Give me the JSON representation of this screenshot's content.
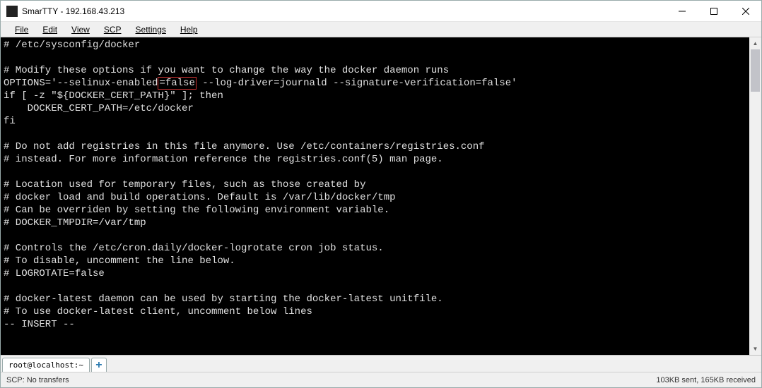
{
  "window": {
    "title": "SmarTTY - 192.168.43.213"
  },
  "menu": {
    "file": "File",
    "edit": "Edit",
    "view": "View",
    "scp": "SCP",
    "settings": "Settings",
    "help": "Help"
  },
  "terminal": {
    "lines": [
      "# /etc/sysconfig/docker",
      "",
      "# Modify these options if you want to change the way the docker daemon runs",
      "OPTIONS='--selinux-enabled=false --log-driver=journald --signature-verification=false'",
      "if [ -z \"${DOCKER_CERT_PATH}\" ]; then",
      "    DOCKER_CERT_PATH=/etc/docker",
      "fi",
      "",
      "# Do not add registries in this file anymore. Use /etc/containers/registries.conf",
      "# instead. For more information reference the registries.conf(5) man page.",
      "",
      "# Location used for temporary files, such as those created by",
      "# docker load and build operations. Default is /var/lib/docker/tmp",
      "# Can be overriden by setting the following environment variable.",
      "# DOCKER_TMPDIR=/var/tmp",
      "",
      "# Controls the /etc/cron.daily/docker-logrotate cron job status.",
      "# To disable, uncomment the line below.",
      "# LOGROTATE=false",
      "",
      "# docker-latest daemon can be used by starting the docker-latest unitfile.",
      "# To use docker-latest client, uncomment below lines",
      "-- INSERT --"
    ],
    "highlight": {
      "line_index": 3,
      "text": "=false"
    }
  },
  "tabs": {
    "active": "root@localhost:~",
    "add_icon": "+"
  },
  "status": {
    "left": "SCP: No transfers",
    "right": "103KB sent, 165KB received"
  }
}
